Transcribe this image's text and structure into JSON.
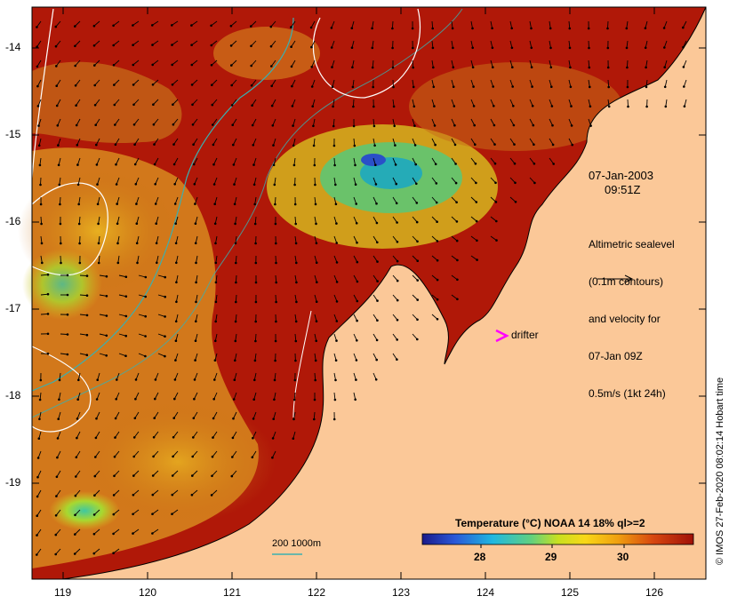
{
  "map": {
    "date": "07-Jan-2003",
    "time": "09:51Z",
    "info_lines": [
      "Altimetric sealevel",
      "(0.1m contours)",
      "and velocity for",
      "07-Jan 09Z",
      "0.5m/s (1kt 24h)"
    ],
    "drifter_label": "drifter",
    "credit": "© IMOS 27-Feb-2020 08:02:14 Hobart time",
    "depth_legend": "200  1000m",
    "x_ticks": [
      "119",
      "120",
      "121",
      "122",
      "123",
      "124",
      "125",
      "126"
    ],
    "y_ticks": [
      "-14",
      "-15",
      "-16",
      "-17",
      "-18",
      "-19"
    ],
    "colorbar": {
      "title": "Temperature (°C) NOAA 14 18% ql>=2",
      "labels": [
        "28",
        "29",
        "30"
      ]
    },
    "colors": {
      "land": "#fbc898",
      "hot_sst": "#b01808",
      "warm_sst": "#d88a1e",
      "cool_sst": "#1ea8c0",
      "drifter": "#ff00ff",
      "isobath": "#3ab0b0",
      "contour": "#ffffff"
    }
  }
}
